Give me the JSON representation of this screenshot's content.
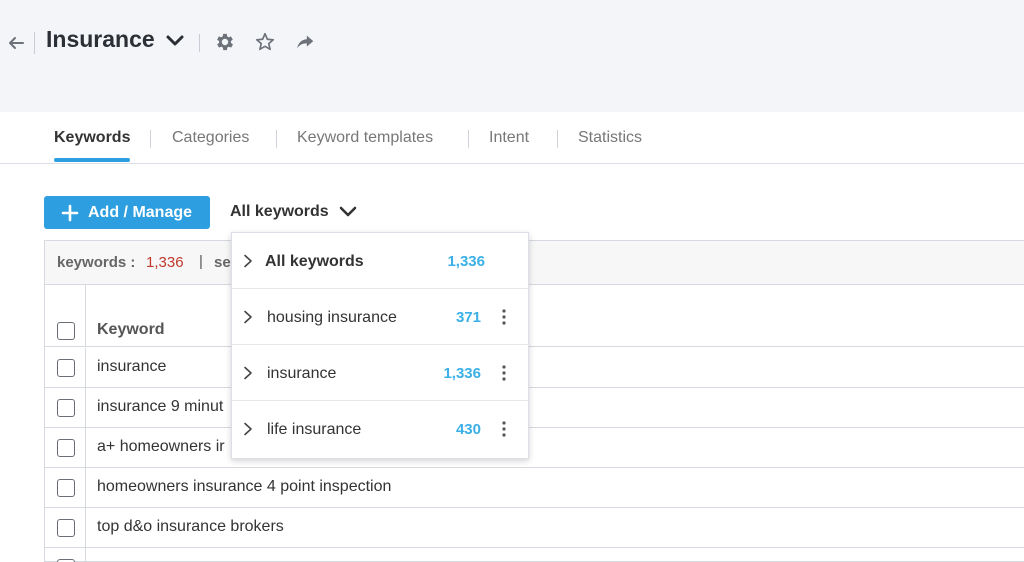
{
  "header": {
    "title": "Insurance"
  },
  "tabs": [
    {
      "label": "Keywords",
      "active": true
    },
    {
      "label": "Categories",
      "active": false
    },
    {
      "label": "Keyword templates",
      "active": false
    },
    {
      "label": "Intent",
      "active": false
    },
    {
      "label": "Statistics",
      "active": false
    }
  ],
  "toolbar": {
    "add_label": "Add / Manage",
    "filter_label": "All keywords"
  },
  "info": {
    "keywords_label": "keywords :",
    "keywords_count": "1,336",
    "separator": "|",
    "next_label": "se"
  },
  "table": {
    "column_header": "Keyword",
    "rows": [
      "insurance",
      "insurance 9 minut",
      "a+ homeowners ir",
      "homeowners insurance 4 point inspection",
      "top d&o insurance brokers"
    ]
  },
  "dropdown": {
    "items": [
      {
        "name": "All keywords",
        "count": "1,336"
      },
      {
        "name": "housing insurance",
        "count": "371"
      },
      {
        "name": "insurance",
        "count": "1,336"
      },
      {
        "name": "life insurance",
        "count": "430"
      }
    ]
  },
  "colors": {
    "accent": "#2d9ee0",
    "count_blue": "#3ab0e6",
    "count_red": "#c0392b"
  }
}
